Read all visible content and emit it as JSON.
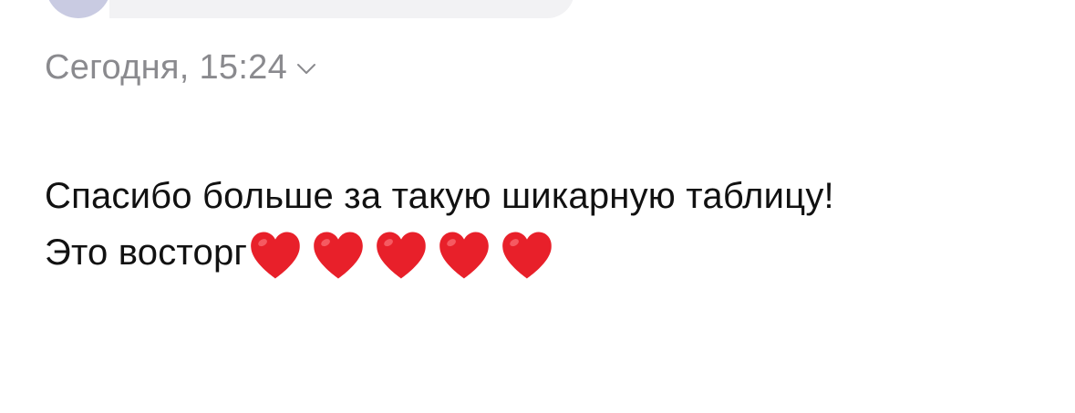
{
  "colors": {
    "background": "#ffffff",
    "meta_text": "#8a8a8e",
    "body_text": "#111111",
    "heart": "#e8202a",
    "previous_bubble": "#f2f2f4",
    "previous_avatar": "#c9cbe2"
  },
  "date_header": {
    "label": "Сегодня, 15:24",
    "icon": "chevron-down-icon"
  },
  "message": {
    "line1": "Спасибо больше за такую шикарную таблицу!",
    "line2": "Это восторг",
    "emoji": "❤️",
    "emoji_count": 5
  }
}
